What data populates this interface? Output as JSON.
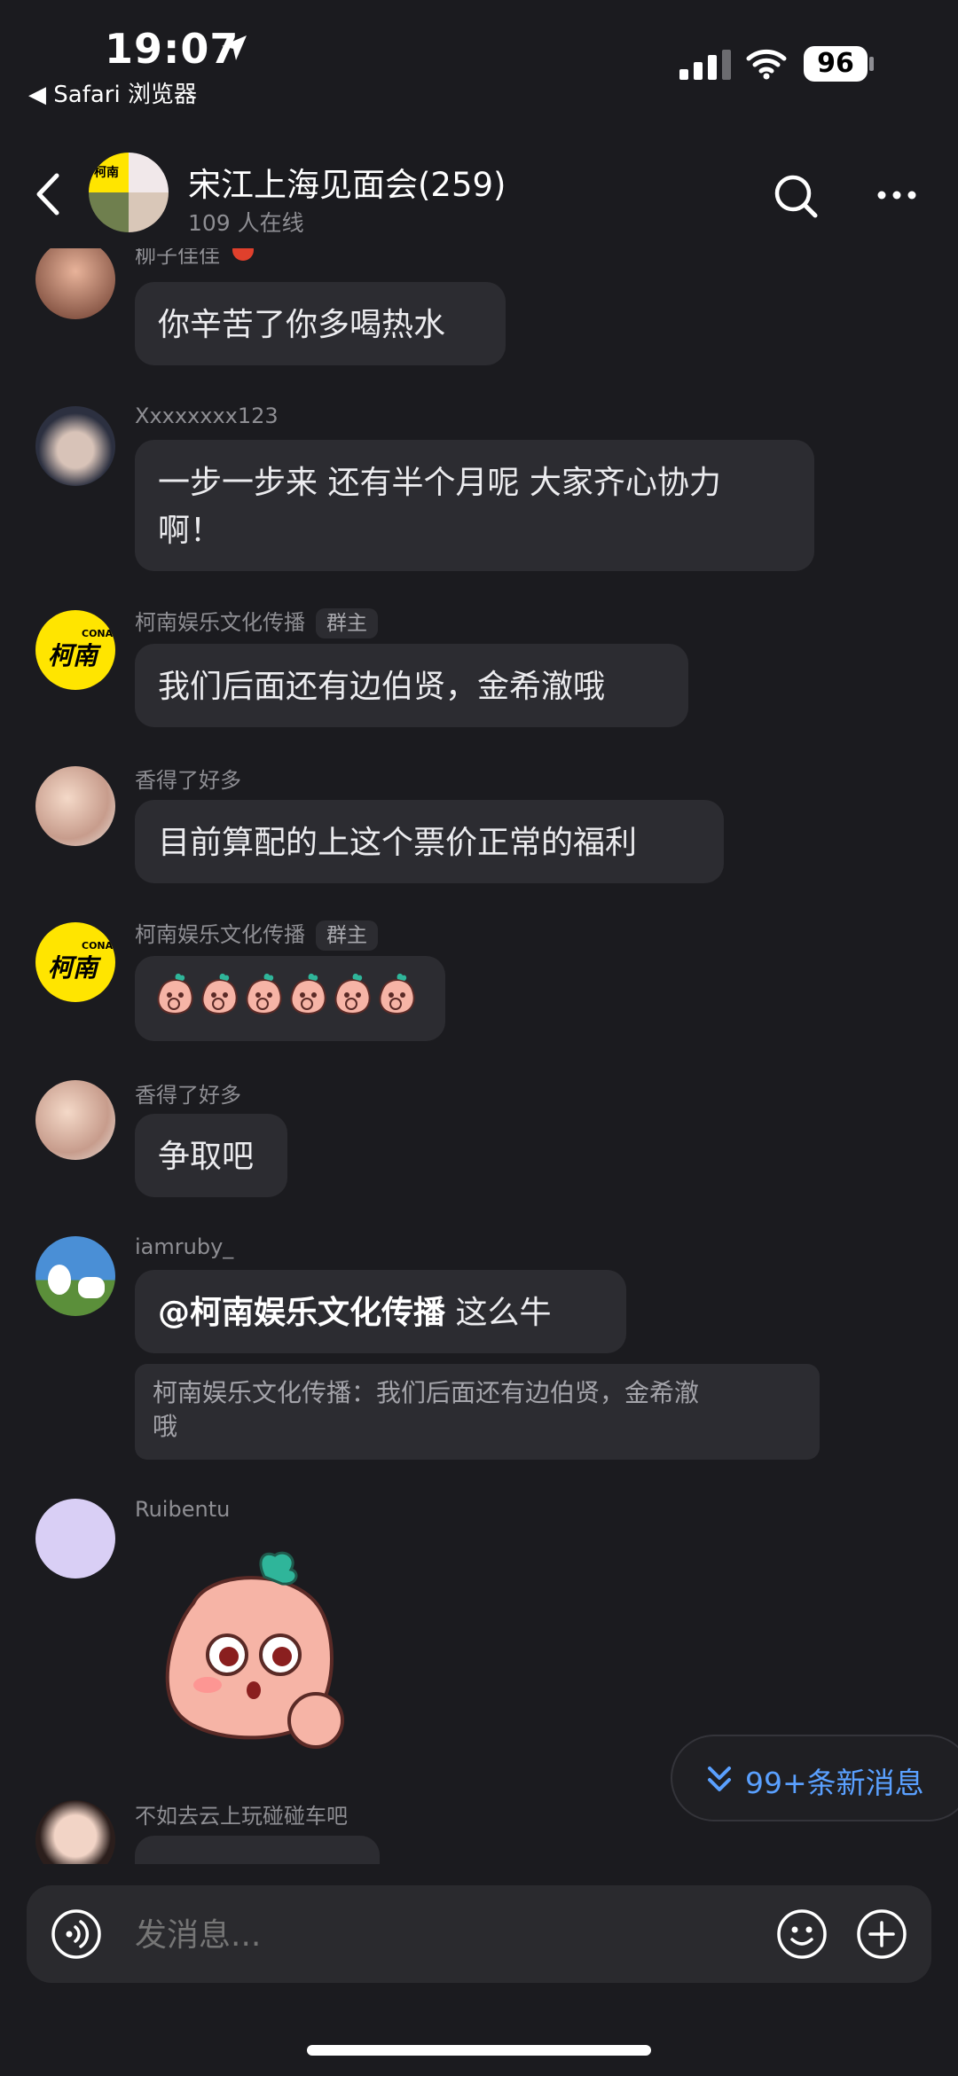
{
  "status": {
    "time": "19:07",
    "back_app": "◀ Safari 浏览器",
    "battery": "96"
  },
  "header": {
    "title": "宋江上海见面会(259)",
    "online": "109 人在线"
  },
  "messages": [
    {
      "sender": "柳子佳佳",
      "text": "你辛苦了你多喝热水"
    },
    {
      "sender": "Xxxxxxxx123",
      "text_line1": "一步一步来 还有半个月呢 大家齐心协力",
      "text_line2": "啊！"
    },
    {
      "sender": "柯南娱乐文化传播",
      "badge": "群主",
      "text": "我们后面还有边伯贤，金希澈哦"
    },
    {
      "sender": "香得了好多",
      "text": "目前算配的上这个票价正常的福利"
    },
    {
      "sender": "柯南娱乐文化传播",
      "badge": "群主",
      "sticker_count": 6
    },
    {
      "sender": "香得了好多",
      "text": "争取吧"
    },
    {
      "sender": "iamruby_",
      "mention": "@柯南娱乐文化传播",
      "text": " 这么牛",
      "quote_line1": "柯南娱乐文化传播：我们后面还有边伯贤，金希澈",
      "quote_line2": "哦"
    },
    {
      "sender": "Ruibentu"
    },
    {
      "sender": "不如去云上玩碰碰车吧"
    }
  ],
  "avatar_logo_text": {
    "top": "CONAN",
    "main": "柯南"
  },
  "new_messages": "99+条新消息",
  "input": {
    "placeholder": "发消息..."
  },
  "colors": {
    "background": "#1b1b1f",
    "bubble": "#2c2c31",
    "accent": "#5aa0ff",
    "logo_yellow": "#ffe500"
  }
}
